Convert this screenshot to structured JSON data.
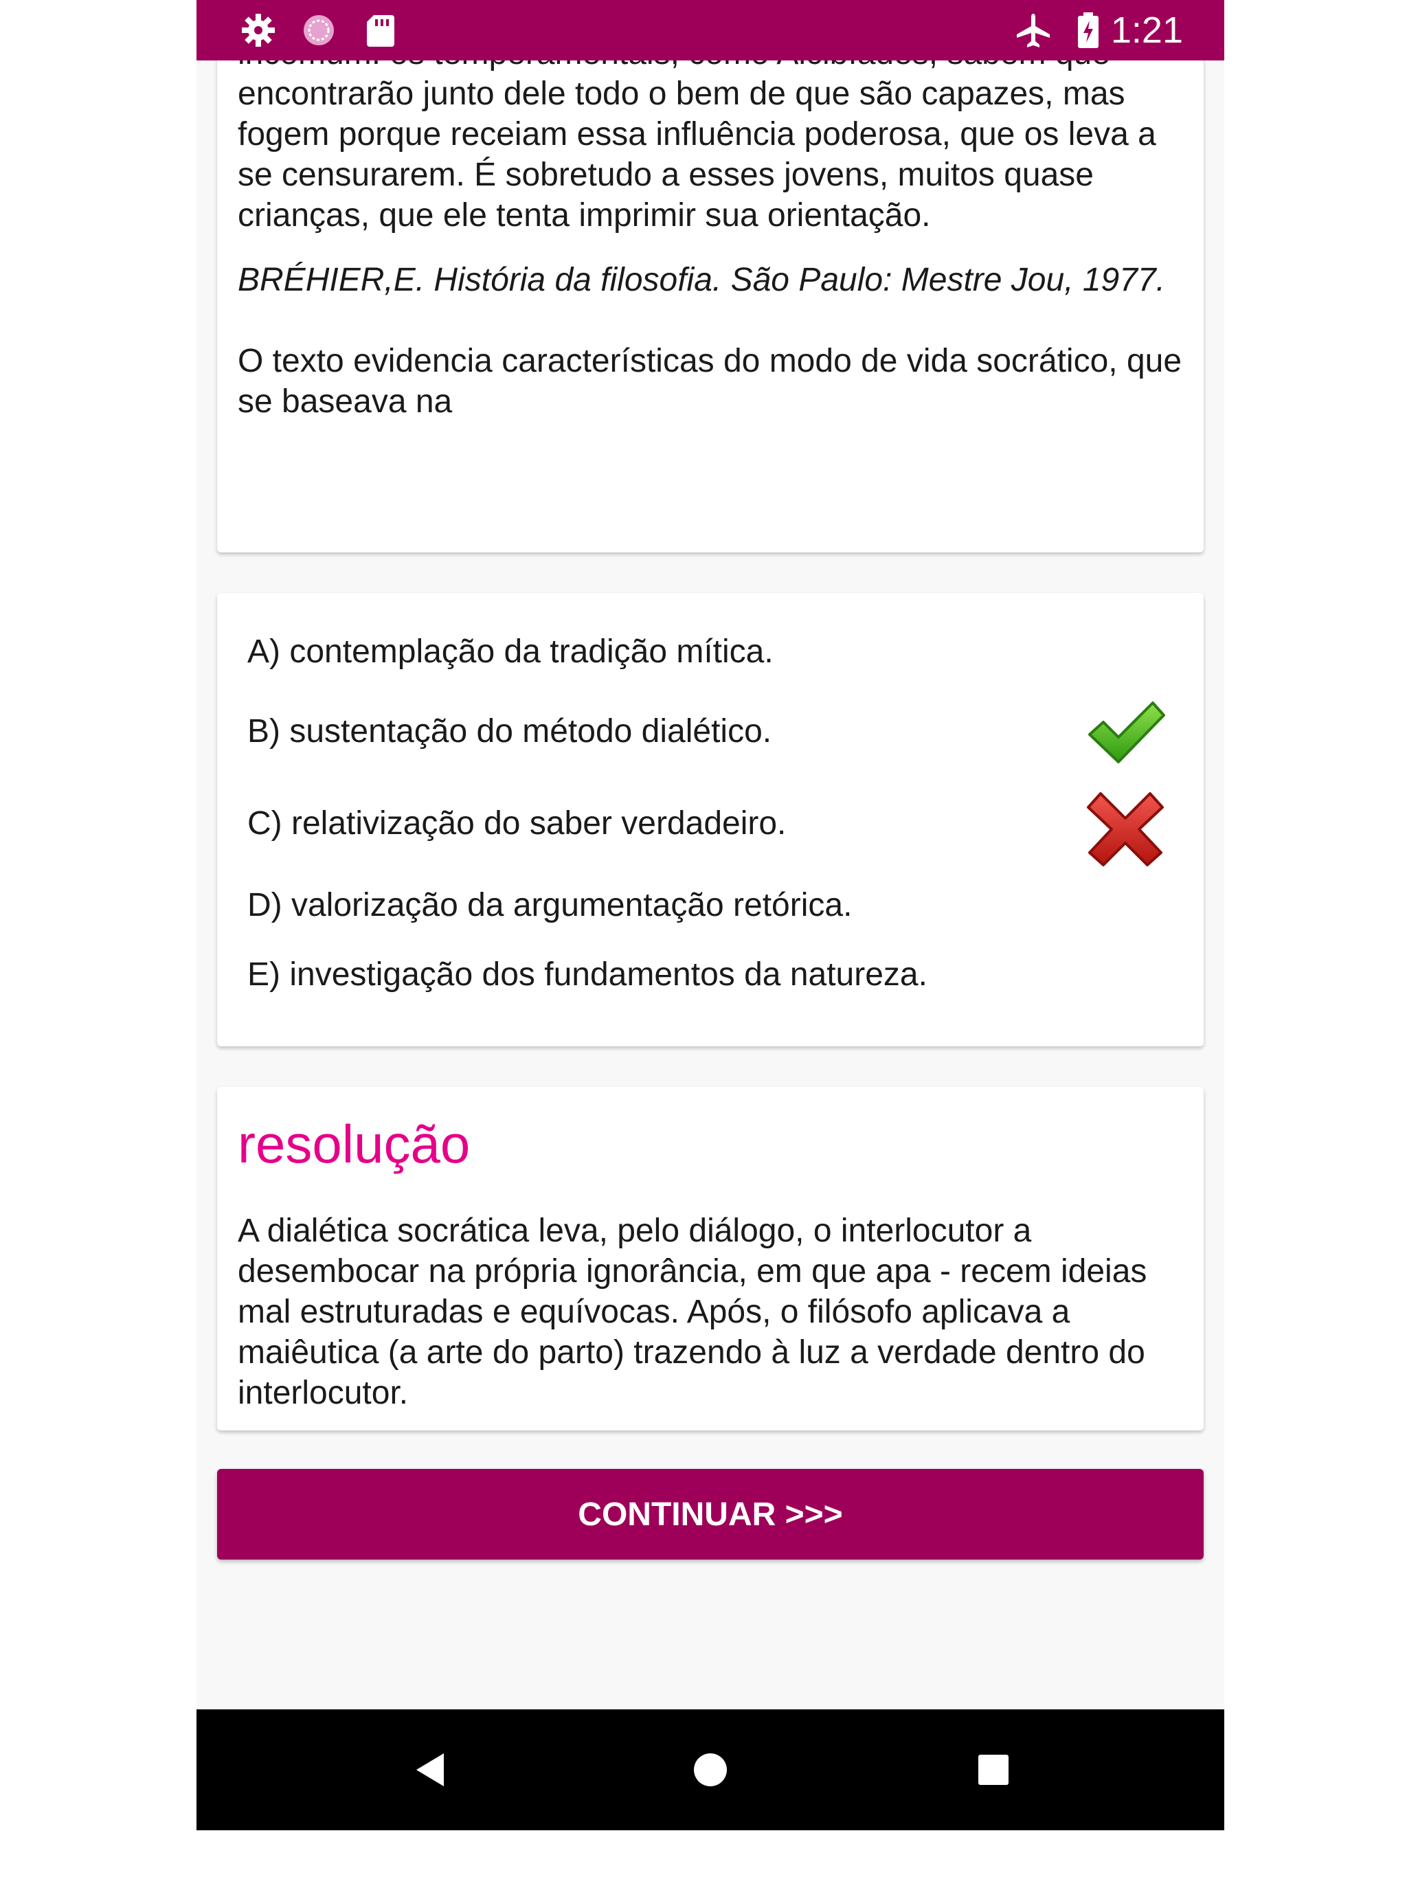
{
  "status_bar": {
    "time": "1:21",
    "icons": [
      "gear-icon",
      "sync-icon",
      "sd-card-icon",
      "airplane-icon",
      "battery-charging-icon"
    ],
    "color": "#9e0059"
  },
  "question": {
    "cut_top_line": "incomum: os temperamentais, como Alcibíades, sabem que",
    "paragraph": "encontrarão junto dele todo o bem de que são capazes, mas fogem porque receiam essa influência poderosa, que os leva a se censurarem. É sobretudo a esses jovens, muitos quase crianças, que ele tenta imprimir sua orientação.",
    "citation": "BRÉHIER,E. História da filosofia. São Paulo: Mestre Jou, 1977.",
    "prompt": "O texto evidencia características do modo de vida socrático, que se baseava na"
  },
  "options": [
    {
      "label": "A) contemplação da tradição mítica.",
      "mark": "none"
    },
    {
      "label": "B) sustentação do método dialético.",
      "mark": "correct"
    },
    {
      "label": "C) relativização do saber verdadeiro.",
      "mark": "wrong"
    },
    {
      "label": "D) valorização da argumentação retórica.",
      "mark": "none"
    },
    {
      "label": "E) investigação dos fundamentos da natureza.",
      "mark": "none"
    }
  ],
  "resolution": {
    "title": "resolução",
    "text": "A dialética socrática leva, pelo diálogo, o interlocutor a desembocar na própria ignorância, em que apa - recem ideias mal estruturadas e equívocas. Após, o filósofo aplicava a maiêutica (a arte do parto) trazendo à luz a verdade dentro do interlocutor.",
    "title_color": "#e5008a"
  },
  "continue_button": {
    "label": "CONTINUAR >>>",
    "color": "#9e0059"
  },
  "nav_bar": {
    "buttons": [
      "back-icon",
      "home-icon",
      "recents-icon"
    ]
  }
}
